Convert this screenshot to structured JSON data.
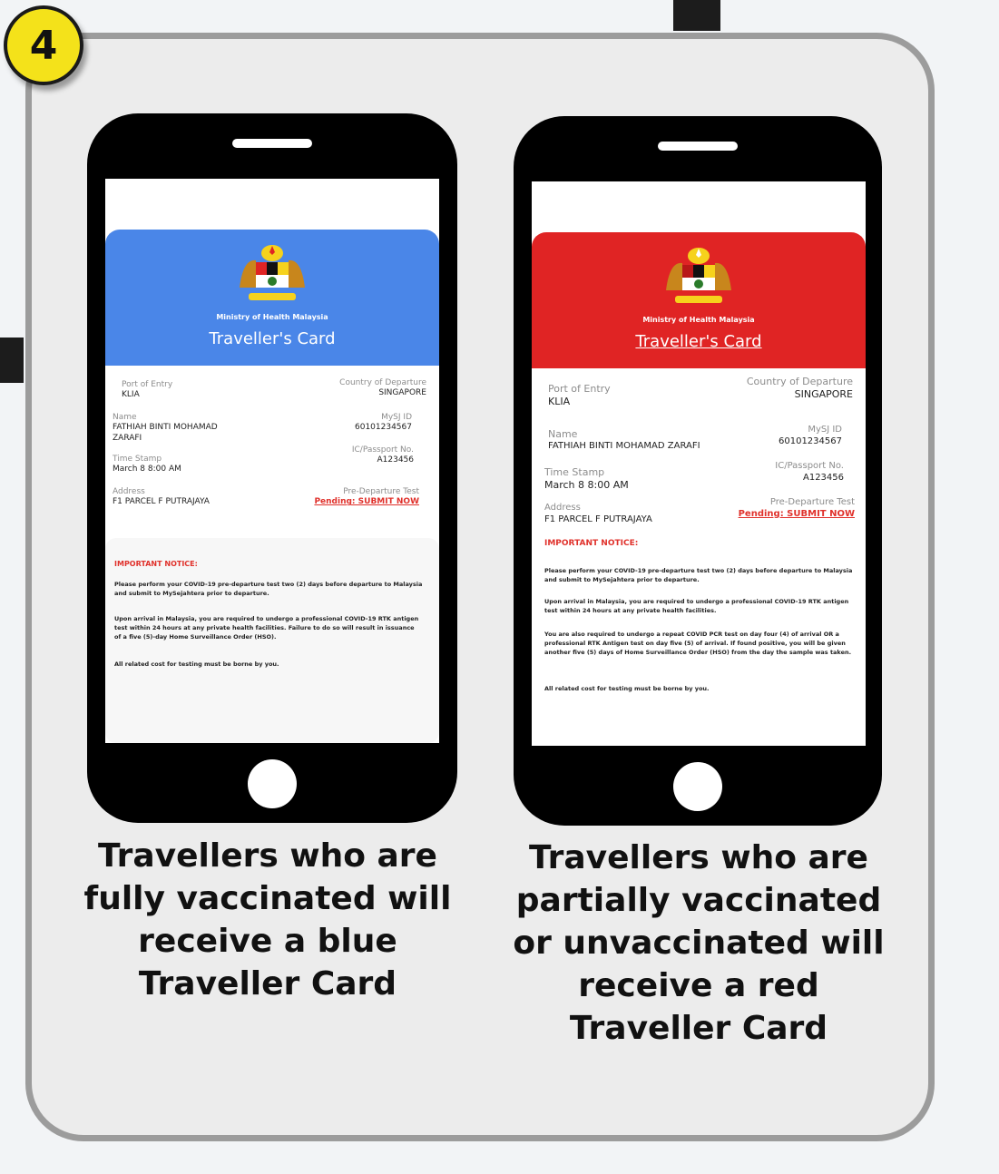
{
  "step_badge": "4",
  "cards": [
    {
      "color": "#4a86e8",
      "ministry": "Ministry of Health Malaysia",
      "title": "Traveller's Card",
      "port_of_entry_label": "Port of Entry",
      "port_of_entry": "KLIA",
      "country_label": "Country of Departure",
      "country": "SINGAPORE",
      "name_label": "Name",
      "name": "FATHIAH BINTI MOHAMAD ZARAFI",
      "mysj_label": "MySJ ID",
      "mysj": "60101234567",
      "passport_label": "IC/Passport No.",
      "passport": "A123456",
      "timestamp_label": "Time Stamp",
      "timestamp": "March 8  8:00 AM",
      "address_label": "Address",
      "address": "F1 PARCEL F PUTRAJAYA",
      "predeparture_label": "Pre-Departure Test",
      "predeparture_status": "Pending: SUBMIT NOW",
      "notice_title": "IMPORTANT NOTICE:",
      "notices": [
        "Please perform your COVID-19 pre-departure test two (2) days before departure to Malaysia and submit to MySejahtera prior to departure.",
        "Upon arrival in Malaysia, you are required to undergo a professional COVID-19 RTK antigen test within 24 hours at any private health facilities. Failure to do so will result in issuance of a five (5)-day Home Surveillance Order (HSO).",
        "All related cost for testing must be borne by you."
      ]
    },
    {
      "color": "#e02424",
      "ministry": "Ministry of Health Malaysia",
      "title": "Traveller's Card",
      "port_of_entry_label": "Port of Entry",
      "port_of_entry": "KLIA",
      "country_label": "Country of Departure",
      "country": "SINGAPORE",
      "name_label": "Name",
      "name": "FATHIAH BINTI MOHAMAD ZARAFI",
      "mysj_label": "MySJ ID",
      "mysj": "60101234567",
      "passport_label": "IC/Passport No.",
      "passport": "A123456",
      "timestamp_label": "Time Stamp",
      "timestamp": "March 8  8:00 AM",
      "address_label": "Address",
      "address": "F1 PARCEL F PUTRAJAYA",
      "predeparture_label": "Pre-Departure Test",
      "predeparture_status": "Pending: SUBMIT NOW",
      "notice_title": "IMPORTANT NOTICE:",
      "notices": [
        "Please perform your COVID-19 pre-departure test two (2) days before departure to Malaysia and submit to MySejahtera prior to departure.",
        "Upon arrival in Malaysia, you are required to undergo a professional COVID-19 RTK antigen test within 24 hours at any private health facilities.",
        "You are also required to undergo a repeat COVID PCR test on day four (4) of arrival OR a professional RTK Antigen test on day five (5) of arrival. If found positive, you will be given another five (5) days of Home Surveillance Order (HSO) from the day the sample was taken.",
        "All related cost for testing must be borne by you."
      ]
    }
  ],
  "captions": {
    "left": [
      "Travellers who are",
      "fully vaccinated will",
      "receive a blue",
      "Traveller Card"
    ],
    "right": [
      "Travellers who are",
      "partially vaccinated",
      "or  unvaccinated will",
      "receive a red",
      "Traveller Card"
    ]
  }
}
